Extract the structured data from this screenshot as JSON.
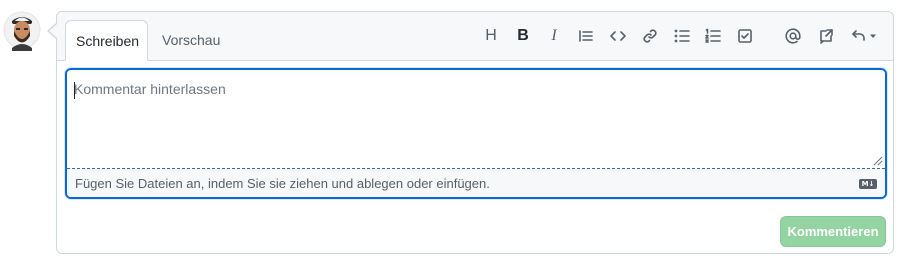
{
  "tabs": [
    {
      "label": "Schreiben",
      "active": true
    },
    {
      "label": "Vorschau",
      "active": false
    }
  ],
  "toolbar": [
    {
      "icon": "heading-icon",
      "label": "H"
    },
    {
      "icon": "bold-icon",
      "label": "B"
    },
    {
      "icon": "italic-icon",
      "label": "I"
    },
    {
      "icon": "quote-icon"
    },
    {
      "icon": "code-icon"
    },
    {
      "icon": "link-icon"
    },
    {
      "icon": "unordered-list-icon"
    },
    {
      "icon": "ordered-list-icon"
    },
    {
      "icon": "task-list-icon"
    },
    {
      "icon": "mention-icon"
    },
    {
      "icon": "cross-reference-icon"
    },
    {
      "icon": "saved-replies-icon"
    }
  ],
  "editor": {
    "placeholder": "Kommentar hinterlassen",
    "value": "",
    "attach_hint": "Fügen Sie Dateien an, indem Sie sie ziehen und ablegen oder einfügen.",
    "markdown_badge": "M↓"
  },
  "submit": {
    "label": "Kommentieren",
    "disabled": true
  },
  "colors": {
    "focus": "#0969da",
    "submit_disabled": "#94d3a2",
    "border": "#d0d7de"
  }
}
